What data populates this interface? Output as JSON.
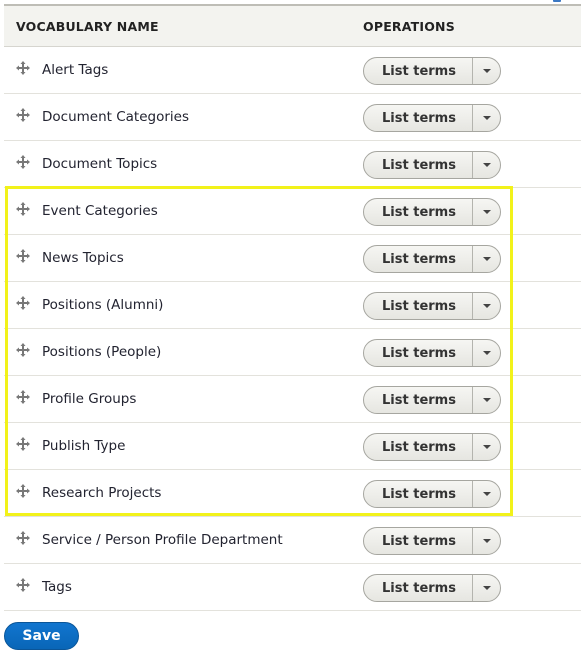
{
  "table": {
    "headers": {
      "name": "VOCABULARY NAME",
      "operations": "OPERATIONS"
    },
    "rows": [
      {
        "name": "Alert Tags",
        "operation": "List terms"
      },
      {
        "name": "Document Categories",
        "operation": "List terms"
      },
      {
        "name": "Document Topics",
        "operation": "List terms"
      },
      {
        "name": "Event Categories",
        "operation": "List terms"
      },
      {
        "name": "News Topics",
        "operation": "List terms"
      },
      {
        "name": "Positions (Alumni)",
        "operation": "List terms"
      },
      {
        "name": "Positions (People)",
        "operation": "List terms"
      },
      {
        "name": "Profile Groups",
        "operation": "List terms"
      },
      {
        "name": "Publish Type",
        "operation": "List terms"
      },
      {
        "name": "Research Projects",
        "operation": "List terms"
      },
      {
        "name": "Service / Person Profile Department",
        "operation": "List terms"
      },
      {
        "name": "Tags",
        "operation": "List terms"
      }
    ]
  },
  "highlight": {
    "color": "#f2f21a",
    "rows": [
      "Event Categories",
      "Research Projects"
    ]
  },
  "actions": {
    "save_label": "Save",
    "save_color": "#0c6fc6"
  }
}
